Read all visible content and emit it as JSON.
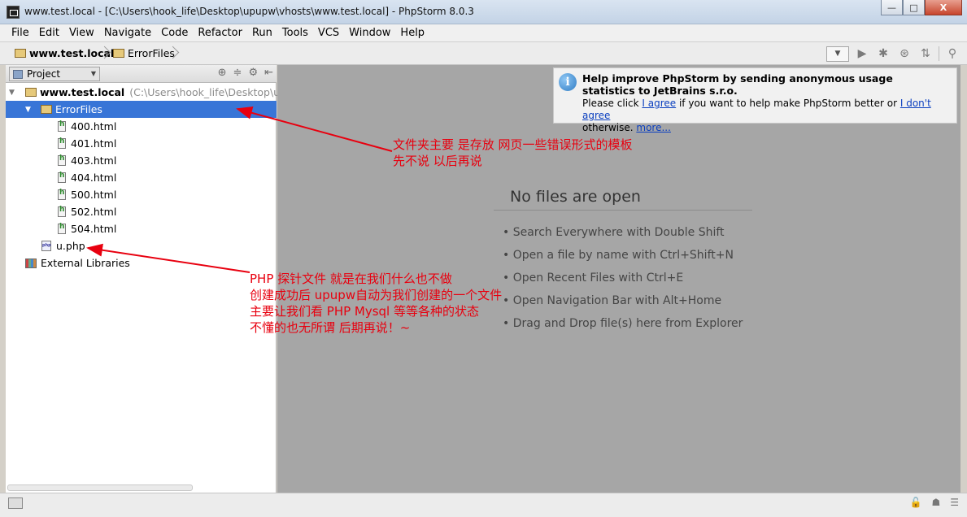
{
  "window": {
    "title": "www.test.local - [C:\\Users\\hook_life\\Desktop\\upupw\\vhosts\\www.test.local] - PhpStorm 8.0.3",
    "buttons": [
      "—",
      "□",
      "X"
    ]
  },
  "menu": [
    {
      "label": "File"
    },
    {
      "label": "Edit"
    },
    {
      "label": "View"
    },
    {
      "label": "Navigate"
    },
    {
      "label": "Code"
    },
    {
      "label": "Refactor"
    },
    {
      "label": "Run"
    },
    {
      "label": "Tools"
    },
    {
      "label": "VCS"
    },
    {
      "label": "Window"
    },
    {
      "label": "Help"
    }
  ],
  "breadcrumb": {
    "root": "www.test.local",
    "folder": "ErrorFiles"
  },
  "project_panel": {
    "selector_label": "Project",
    "tree": {
      "root_label": "www.test.local",
      "root_path": "(C:\\Users\\hook_life\\Desktop\\upup",
      "folder_label": "ErrorFiles",
      "files": [
        "400.html",
        "401.html",
        "403.html",
        "404.html",
        "500.html",
        "502.html",
        "504.html"
      ],
      "php_file": "u.php",
      "external_libraries": "External Libraries"
    }
  },
  "notification": {
    "title": "Help improve PhpStorm by sending anonymous usage statistics to JetBrains s.r.o.",
    "text_1": "Please click ",
    "agree_link": "I agree",
    "text_2": " if you want to help make PhpStorm better or ",
    "disagree_link": "I don't agree",
    "text_3": "otherwise. ",
    "more_link": "more..."
  },
  "editor": {
    "empty_title": "No files are open",
    "hints": [
      "• Search Everywhere with Double Shift",
      "• Open a file by name with Ctrl+Shift+N",
      "• Open Recent Files with Ctrl+E",
      "• Open Navigation Bar with Alt+Home",
      "• Drag and Drop file(s) here from Explorer"
    ]
  },
  "annotations": {
    "note_1": [
      "文件夹主要 是存放  网页一些错误形式的模板",
      "先不说 以后再说"
    ],
    "note_2": [
      "PHP 探针文件       就是在我们什么也不做",
      "创建成功后 upupw自动为我们创建的一个文件",
      "主要让我们看 PHP  Mysql  等等各种的状态",
      "不懂的也无所谓 后期再说！~"
    ],
    "color": "#e8000f"
  }
}
